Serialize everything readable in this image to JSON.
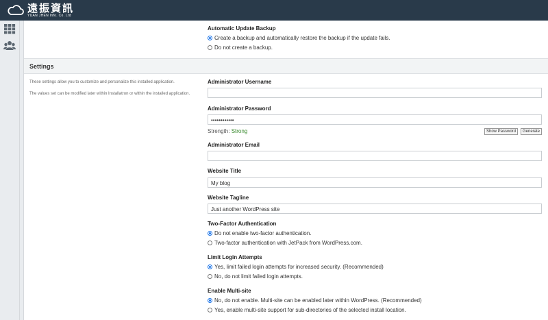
{
  "brand": {
    "title": "遠振資訊",
    "subtitle": "YUAN JHEN Info. Co. Ltd"
  },
  "nav": {
    "icons": [
      "grid-icon",
      "users-icon"
    ]
  },
  "auto_update_backup": {
    "heading": "Automatic Update Backup",
    "options": [
      {
        "label": "Create a backup and automatically restore the backup if the update fails.",
        "checked": true
      },
      {
        "label": "Do not create a backup.",
        "checked": false
      }
    ]
  },
  "settings": {
    "title": "Settings",
    "desc1": "These settings allow you to customize and personalize this installed application.",
    "desc2": "The values set can be modified later within Installatron or within the installed application."
  },
  "admin_username": {
    "label": "Administrator Username",
    "value": ""
  },
  "admin_password": {
    "label": "Administrator Password",
    "value": "••••••••••••",
    "strength_label": "Strength:",
    "strength_value": "Strong",
    "show_label": "Show Password",
    "generate_label": "Generate"
  },
  "admin_email": {
    "label": "Administrator Email",
    "value": ""
  },
  "website_title": {
    "label": "Website Title",
    "value": "My blog"
  },
  "website_tagline": {
    "label": "Website Tagline",
    "value": "Just another WordPress site"
  },
  "two_factor": {
    "heading": "Two-Factor Authentication",
    "options": [
      {
        "label": "Do not enable two-factor authentication.",
        "checked": true
      },
      {
        "label": "Two-factor authentication with JetPack from WordPress.com.",
        "checked": false
      }
    ]
  },
  "limit_login": {
    "heading": "Limit Login Attempts",
    "options": [
      {
        "label": "Yes, limit failed login attempts for increased security. (Recommended)",
        "checked": true
      },
      {
        "label": "No, do not limit failed login attempts.",
        "checked": false
      }
    ]
  },
  "multisite": {
    "heading": "Enable Multi-site",
    "options": [
      {
        "label": "No, do not enable. Multi-site can be enabled later within WordPress. (Recommended)",
        "checked": true
      },
      {
        "label": "Yes, enable multi-site support for sub-directories of the selected install location.",
        "checked": false
      }
    ]
  },
  "colors": {
    "topbar": "#293a4a",
    "radio_checked": "#1a73e8",
    "strength_good": "#3a8a2e"
  }
}
